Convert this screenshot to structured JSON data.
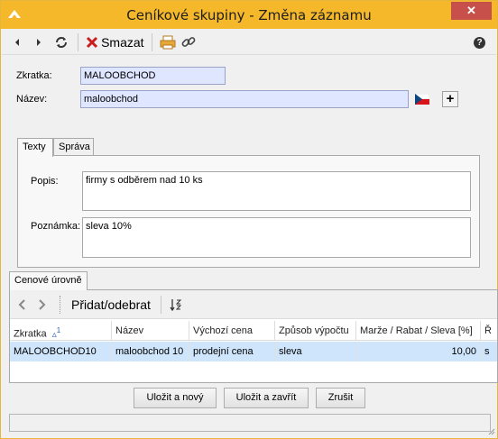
{
  "window": {
    "title": "Ceníkové skupiny - Změna záznamu",
    "close_label": "✕"
  },
  "toolbar": {
    "delete_label": "Smazat",
    "help_label": "?"
  },
  "form": {
    "zkratka_label": "Zkratka:",
    "zkratka_value": "MALOOBCHOD",
    "nazev_label": "Název:",
    "nazev_value": "maloobchod",
    "add_label": "+"
  },
  "tabs": [
    {
      "label": "Texty"
    },
    {
      "label": "Správa"
    }
  ],
  "texty": {
    "popis_label": "Popis:",
    "popis_value": "firmy s odběrem nad 10 ks",
    "poznamka_label": "Poznámka:",
    "poznamka_value": "sleva 10%"
  },
  "levels": {
    "tab_label": "Cenové úrovně",
    "add_remove_label": "Přidat/odebrat",
    "columns": [
      "Zkratka",
      "Název",
      "Výchozí cena",
      "Způsob výpočtu",
      "Marže / Rabat / Sleva [%]",
      "Ř"
    ],
    "sort_indicator": "1",
    "rows": [
      {
        "zkratka": "MALOOBCHOD10",
        "nazev": "maloobchod 10",
        "vychozi": "prodejní cena",
        "zpusob": "sleva",
        "marze": "10,00",
        "r": "s"
      }
    ]
  },
  "buttons": {
    "save_new": "Uložit a nový",
    "save_close": "Uložit a zavřít",
    "cancel": "Zrušit"
  },
  "colors": {
    "titlebar": "#f4b82a",
    "close": "#c7504a",
    "field_bg": "#dfe6ff",
    "selected_row": "#cfe5fb",
    "delete_red": "#c81e1e"
  }
}
